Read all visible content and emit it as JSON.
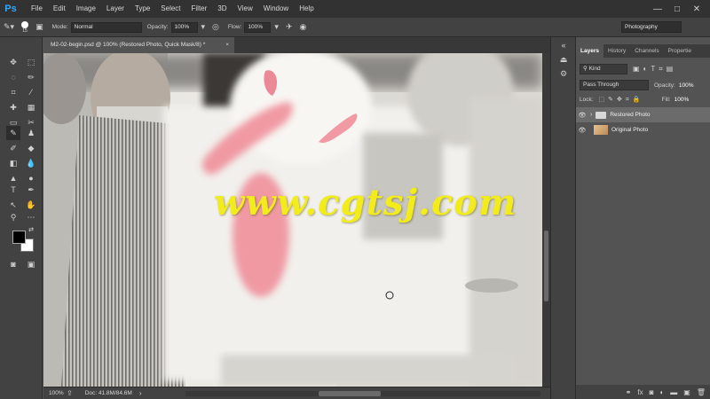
{
  "app": {
    "logo": "Ps"
  },
  "menu": [
    "File",
    "Edit",
    "Image",
    "Layer",
    "Type",
    "Select",
    "Filter",
    "3D",
    "View",
    "Window",
    "Help"
  ],
  "window_controls": {
    "minimize": "—",
    "maximize": "□",
    "close": "✕"
  },
  "options_bar": {
    "brush_size": "15",
    "mode_label": "Mode:",
    "mode_value": "Normal",
    "opacity_label": "Opacity:",
    "opacity_value": "100%",
    "flow_label": "Flow:",
    "flow_value": "100%",
    "workspace": "Photography"
  },
  "document": {
    "tab_title": "M2-02-begin.psd @ 100% (Restored Photo, Quick Mask/8) *",
    "close": "×",
    "watermark": "www.cgtsj.com"
  },
  "status": {
    "zoom": "100%",
    "doc_info": "Doc: 41.8M/84.6M"
  },
  "layers_panel": {
    "tabs": [
      "Layers",
      "History",
      "Channels",
      "Propertie"
    ],
    "kind_label": "Kind",
    "blend_mode": "Pass Through",
    "opacity_label": "Opacity:",
    "opacity_value": "100%",
    "lock_label": "Lock:",
    "fill_label": "Fill:",
    "fill_value": "100%",
    "layers": [
      {
        "name": "Restored Photo",
        "type": "group",
        "selected": true
      },
      {
        "name": "Original Photo",
        "type": "image",
        "selected": false
      }
    ]
  },
  "colors": {
    "accent": "#31a8ff",
    "quick_mask": "#f08a96",
    "watermark": "#f2ec1d"
  }
}
